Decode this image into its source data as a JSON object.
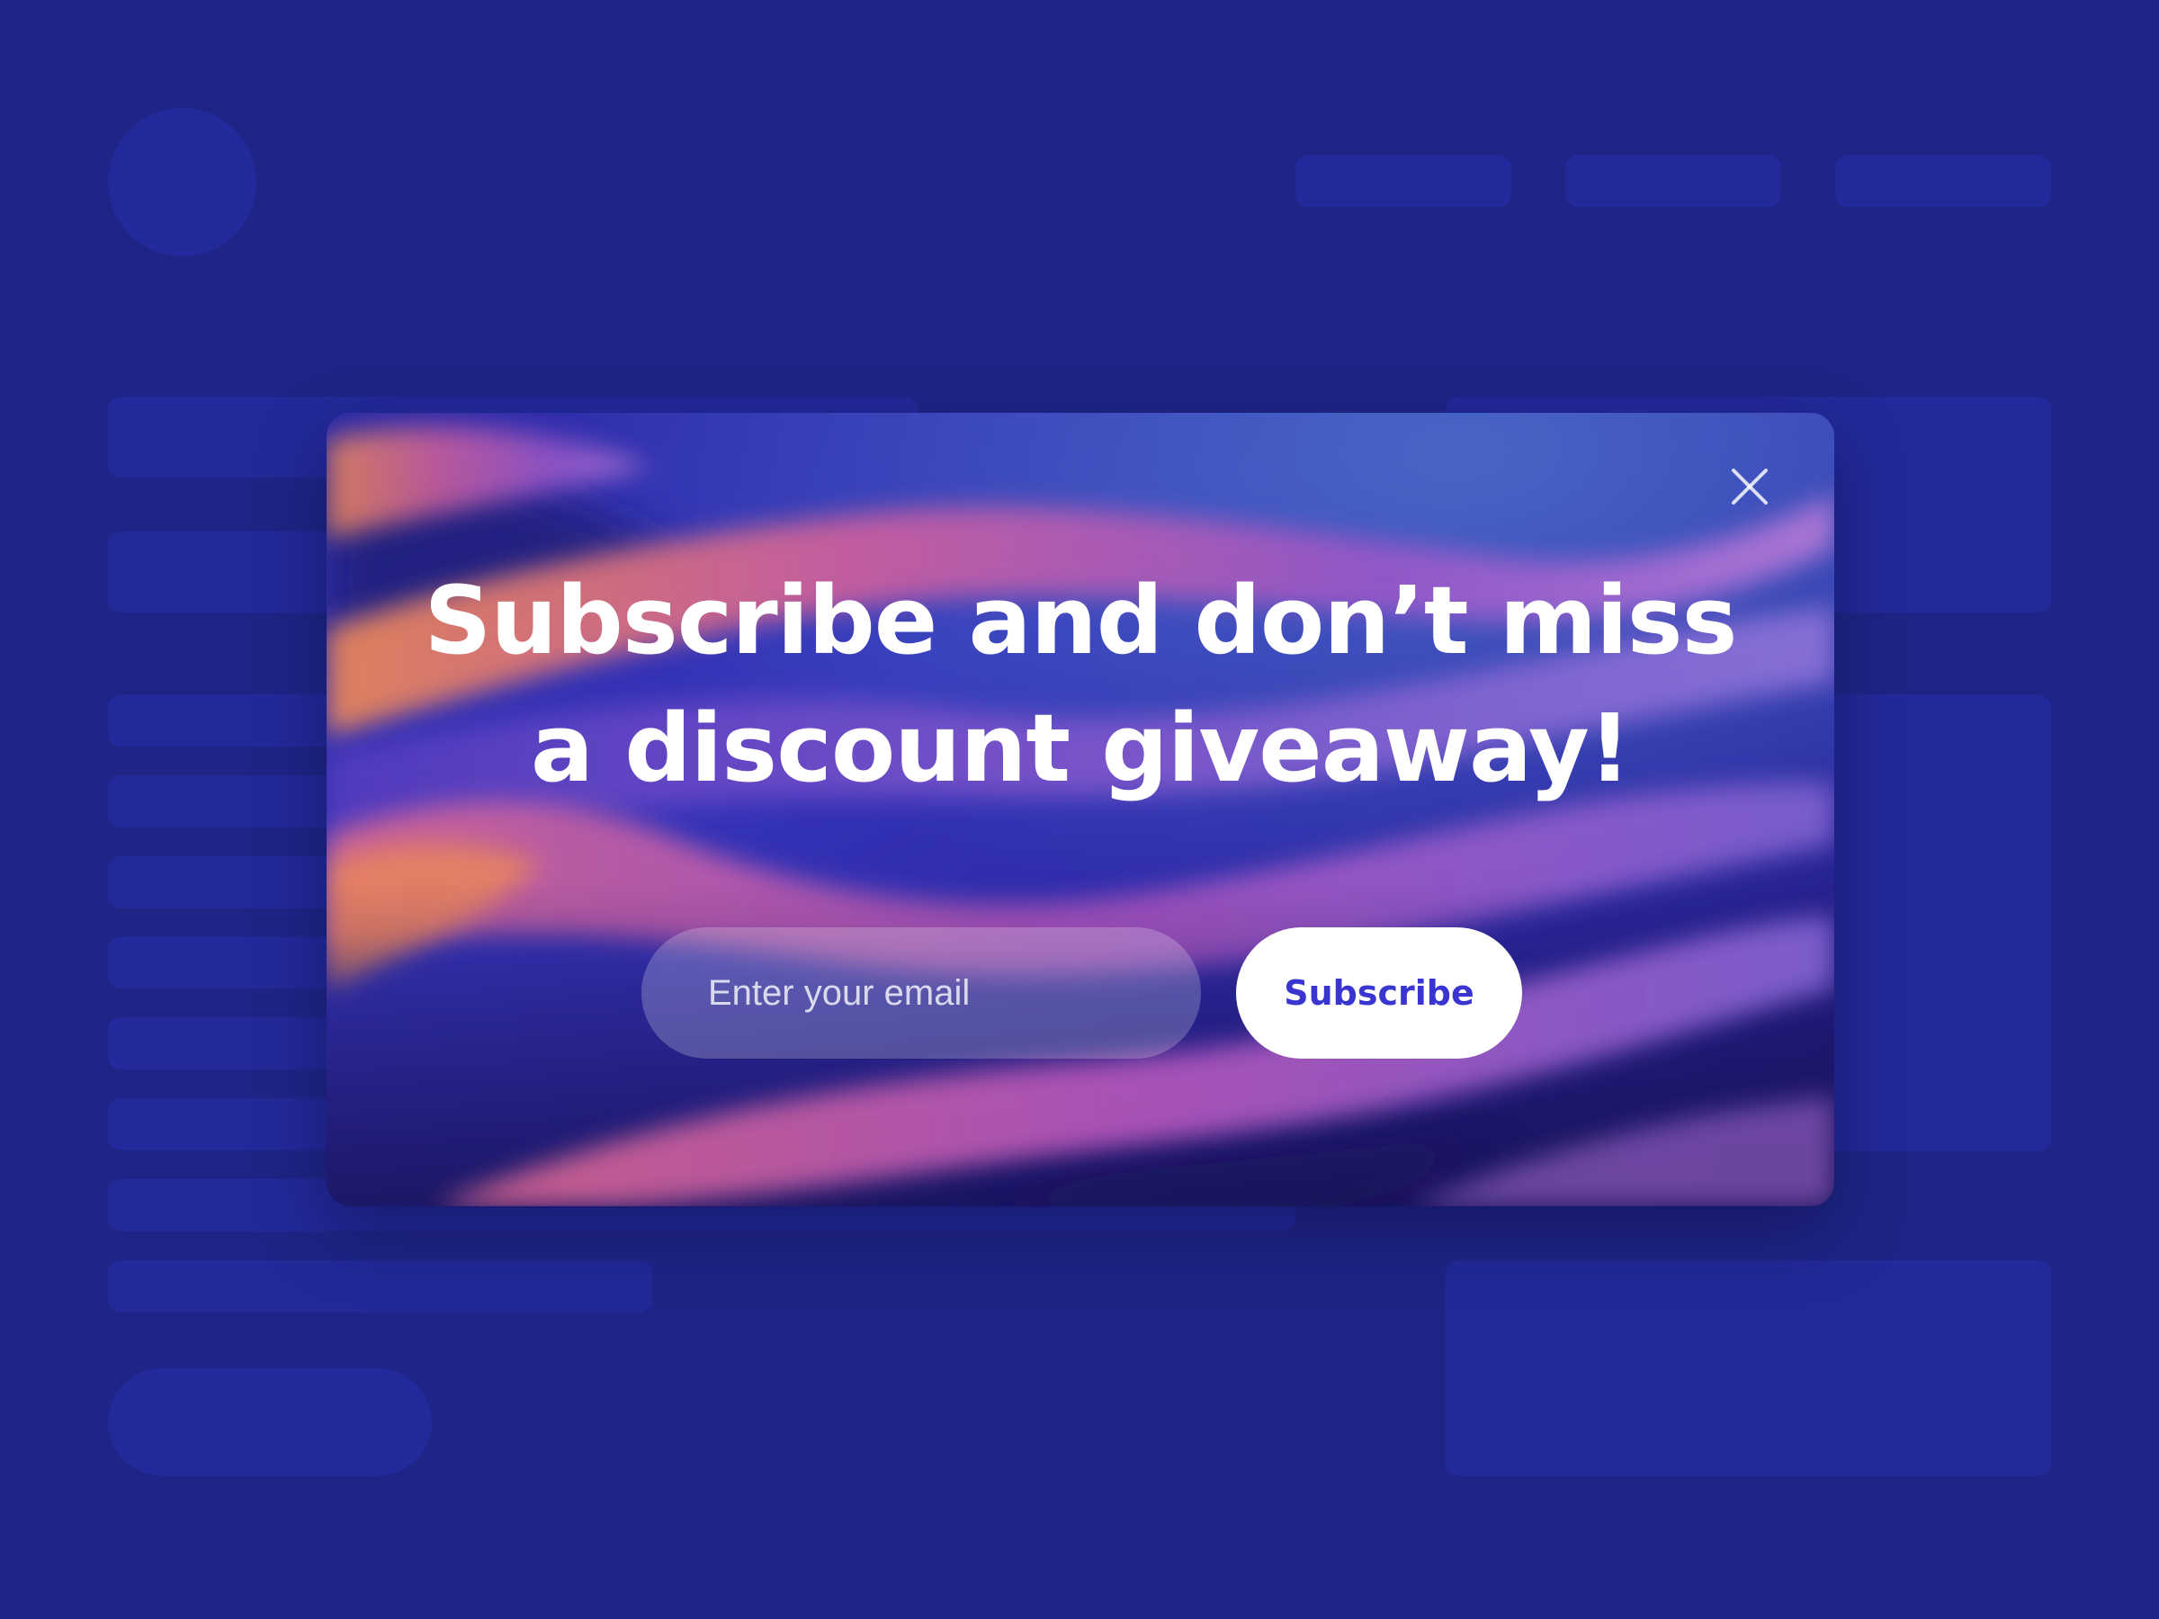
{
  "page": {
    "background_color": "#1F2586",
    "placeholder_color": "#23299A"
  },
  "modal": {
    "headline_line1": "Subscribe and don’t miss",
    "headline_line2": "a discount giveaway!",
    "email_placeholder": "Enter your email",
    "email_value": "",
    "subscribe_label": "Subscribe",
    "close_icon": "close-icon",
    "colors": {
      "button_bg": "#FFFFFF",
      "button_text": "#3A34D1",
      "headline_text": "#FFFFFF"
    }
  }
}
